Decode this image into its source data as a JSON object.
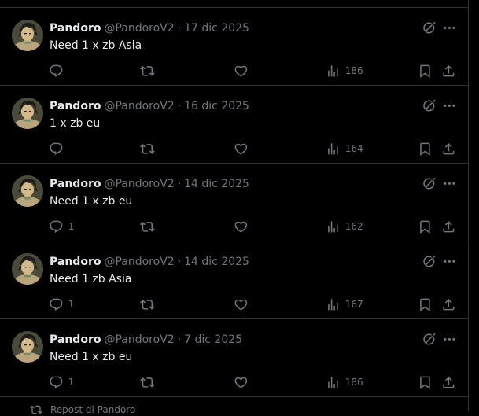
{
  "posts": [
    {
      "display_name": "Pandoro",
      "handle": "@PandoroV2",
      "date": "17 dic 2025",
      "text": "Need 1 x zb Asia",
      "replies": "",
      "reposts": "",
      "likes": "",
      "views": "186"
    },
    {
      "display_name": "Pandoro",
      "handle": "@PandoroV2",
      "date": "16 dic 2025",
      "text": "1 x zb eu",
      "replies": "",
      "reposts": "",
      "likes": "",
      "views": "164"
    },
    {
      "display_name": "Pandoro",
      "handle": "@PandoroV2",
      "date": "14 dic 2025",
      "text": "Need 1 x zb eu",
      "replies": "1",
      "reposts": "",
      "likes": "",
      "views": "162"
    },
    {
      "display_name": "Pandoro",
      "handle": "@PandoroV2",
      "date": "14 dic 2025",
      "text": "Need 1 zb Asia",
      "replies": "1",
      "reposts": "",
      "likes": "",
      "views": "167"
    },
    {
      "display_name": "Pandoro",
      "handle": "@PandoroV2",
      "date": "7 dic 2025",
      "text": "Need 1 x zb eu",
      "replies": "1",
      "reposts": "",
      "likes": "",
      "views": "186"
    }
  ],
  "separator": "·",
  "bottom_peek": {
    "text": "Repost di Pandoro",
    "icon": "repost-icon"
  },
  "icons": {
    "reply": "reply-icon",
    "repost": "repost-icon",
    "like": "heart-icon",
    "views": "views-icon",
    "bookmark": "bookmark-icon",
    "share": "share-icon",
    "grok": "grok-icon",
    "more": "more-icon"
  },
  "colors": {
    "background": "#000000",
    "text_primary": "#e7e9ea",
    "text_secondary": "#71767b",
    "divider": "#2f3336"
  }
}
